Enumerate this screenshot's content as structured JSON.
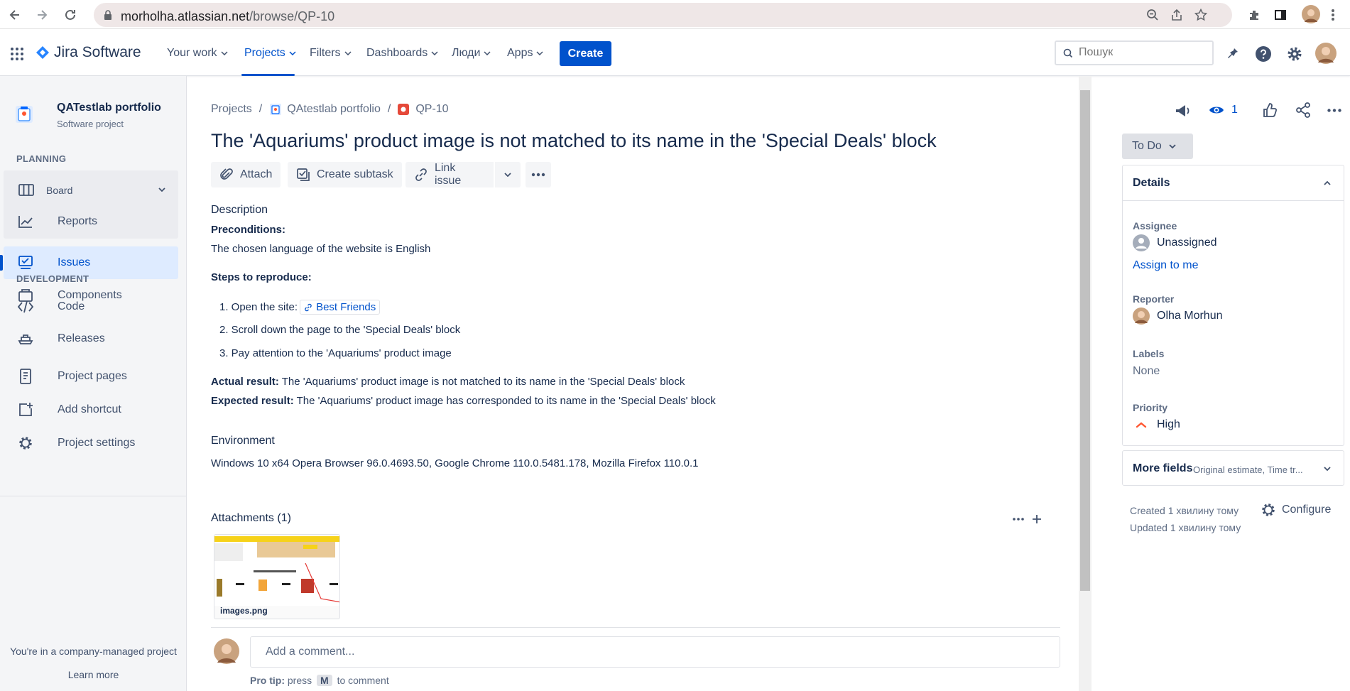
{
  "browser": {
    "url_host": "morholha.atlassian.net",
    "url_path": "/browse/QP-10"
  },
  "topnav": {
    "logo": "Jira Software",
    "menu": [
      {
        "label": "Your work"
      },
      {
        "label": "Projects"
      },
      {
        "label": "Filters"
      },
      {
        "label": "Dashboards"
      },
      {
        "label": "Люди"
      },
      {
        "label": "Apps"
      }
    ],
    "create_label": "Create",
    "search_placeholder": "Пошук"
  },
  "sidebar": {
    "project_name": "QATestlab portfolio",
    "project_type": "Software project",
    "planning_title": "PLANNING",
    "board_label": "Board",
    "reports_label": "Reports",
    "issues_label": "Issues",
    "components_label": "Components",
    "development_title": "DEVELOPMENT",
    "code_label": "Code",
    "releases_label": "Releases",
    "project_pages_label": "Project pages",
    "add_shortcut_label": "Add shortcut",
    "project_settings_label": "Project settings",
    "footer_text": "You're in a company-managed project",
    "learn_more": "Learn more"
  },
  "issue": {
    "breadcrumb": {
      "projects": "Projects",
      "project": "QAtestlab portfolio",
      "key": "QP-10"
    },
    "title": "The 'Aquariums' product image is not matched to its name in the 'Special Deals' block",
    "actions": {
      "attach": "Attach",
      "create_subtask": "Create subtask",
      "link_issue": "Link issue"
    },
    "description_label": "Description",
    "preconditions_title": "Preconditions:",
    "preconditions_text": "The chosen language of the website is English",
    "steps_title": "Steps to reproduce:",
    "step1_prefix": "1. Open the site:",
    "step1_link": "Best Friends",
    "step2": "2. Scroll down the page to the 'Special Deals' block",
    "step3": "3. Pay attention to the 'Aquariums' product image",
    "actual_label": "Actual result:",
    "actual_text": " The 'Aquariums' product image is not matched to its name in the 'Special Deals' block",
    "expected_label": "Expected result:",
    "expected_text": " The 'Aquariums' product image has corresponded to its name in the 'Special Deals' block",
    "environment_label": "Environment",
    "environment_text": "Windows 10 x64 Opera Browser 96.0.4693.50, Google Chrome 110.0.5481.178, Mozilla Firefox 110.0.1",
    "attachments_label": "Attachments (1)",
    "attachment_name": "images.png",
    "comment_placeholder": "Add a comment...",
    "pro_tip_label": "Pro tip:",
    "pro_tip_press": "press",
    "pro_tip_key": "M",
    "pro_tip_suffix": "to comment"
  },
  "right_panel": {
    "watchers_count": "1",
    "status": "To Do",
    "details_title": "Details",
    "assignee_label": "Assignee",
    "assignee_value": "Unassigned",
    "assign_to_me": "Assign to me",
    "reporter_label": "Reporter",
    "reporter_value": "Olha Morhun",
    "labels_label": "Labels",
    "labels_value": "None",
    "priority_label": "Priority",
    "priority_value": "High",
    "more_fields_label": "More fields",
    "more_fields_hint": "Original estimate, Time tr...",
    "created": "Created 1 хвилину тому",
    "updated": "Updated 1 хвилину тому",
    "configure": "Configure"
  },
  "colors": {
    "brand_blue": "#0052CC",
    "priority_high": "#FF5630",
    "sidebar_bg": "#F4F5F7"
  }
}
